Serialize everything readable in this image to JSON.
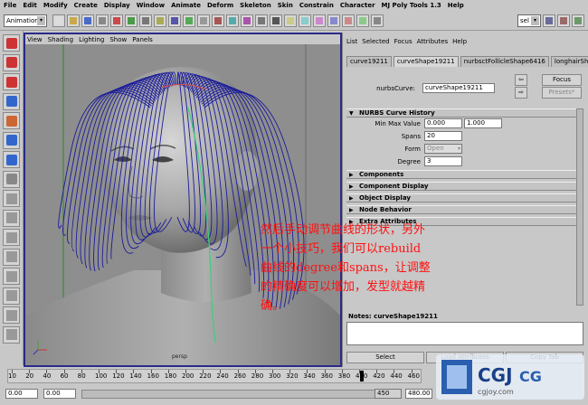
{
  "menubar": [
    "File",
    "Edit",
    "Modify",
    "Create",
    "Display",
    "Window",
    "Animate",
    "Deform",
    "Skeleton",
    "Skin",
    "Constrain",
    "Character",
    "MJ Poly Tools 1.3",
    "Help"
  ],
  "status_line": {
    "mode": "Animation",
    "sel_label": "sel"
  },
  "viewport": {
    "menu": [
      "View",
      "Shading",
      "Lighting",
      "Show",
      "Panels"
    ],
    "axis_label": "persp"
  },
  "attribute_editor": {
    "menu": [
      "List",
      "Selected",
      "Focus",
      "Attributes",
      "Help"
    ],
    "tabs": [
      "curve19211",
      "curveShape19211",
      "nurbsctFollicleShape6416",
      "longhairShape1"
    ],
    "active_tab": 1,
    "node_label": "nurbsCurve:",
    "node_value": "curveShape19211",
    "focus_button": "Focus",
    "presets_button": "Presets*",
    "sections": {
      "history": "NURBS Curve History",
      "components": "Components",
      "component_display": "Component Display",
      "object_display": "Object Display",
      "node_behavior": "Node Behavior",
      "extra_attributes": "Extra Attributes"
    },
    "fields": {
      "min_max_label": "Min Max Value",
      "min_value": "0.000",
      "max_value": "1.000",
      "spans_label": "Spans",
      "spans_value": "20",
      "form_label": "Form",
      "form_value": "Open",
      "degree_label": "Degree",
      "degree_value": "3"
    },
    "notes_label": "Notes: curveShape19211",
    "buttons": {
      "select": "Select",
      "load_attributes": "Load Attributes",
      "copy_tab": "Copy Tab"
    }
  },
  "timeline": {
    "ticks": [
      "10",
      "20",
      "40",
      "60",
      "80",
      "100",
      "120",
      "140",
      "160",
      "180",
      "200",
      "220",
      "240",
      "260",
      "280",
      "300",
      "320",
      "340",
      "360",
      "380",
      "400",
      "420",
      "440",
      "460"
    ],
    "start_field": "0.00",
    "start2_field": "0.00",
    "end_field": "480.00",
    "current_frame": "450"
  },
  "overlay_text": [
    "然后手动调节曲线的形状，另外",
    "一个小技巧，我们可以rebuild",
    "曲线的degree和spans，让调整",
    "的精确度可以增加，发型就越精",
    "确。"
  ],
  "watermark": {
    "brand": "CGJ",
    "sub": "cgjoy.com",
    "tag": "CG"
  },
  "colors": {
    "viewport_border": "#2a2a8a",
    "hair_curve": "#1a1a9a",
    "overlay_text": "#ff1010"
  }
}
